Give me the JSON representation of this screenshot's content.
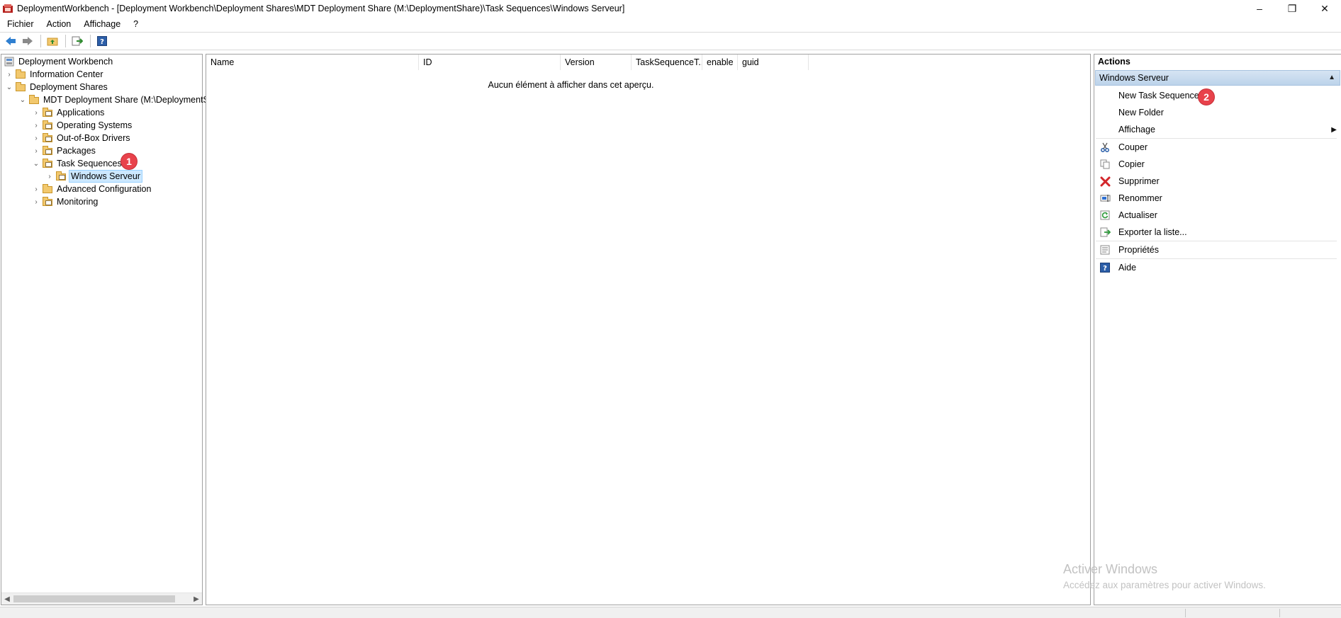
{
  "window": {
    "title": "DeploymentWorkbench - [Deployment Workbench\\Deployment Shares\\MDT Deployment Share (M:\\DeploymentShare)\\Task Sequences\\Windows Serveur]",
    "controls": {
      "minimize": "–",
      "restore": "❐",
      "close": "✕"
    }
  },
  "menu": [
    "Fichier",
    "Action",
    "Affichage",
    "?"
  ],
  "tree": {
    "items": [
      {
        "label": "Deployment Workbench",
        "level": 0,
        "expander": "",
        "icon": "workbench-icon"
      },
      {
        "label": "Information Center",
        "level": 1,
        "expander": "›",
        "icon": "folder-icon"
      },
      {
        "label": "Deployment Shares",
        "level": 1,
        "expander": "⌄",
        "icon": "folder-icon"
      },
      {
        "label": "MDT Deployment Share (M:\\DeploymentShare)",
        "level": 2,
        "expander": "⌄",
        "icon": "folder-icon"
      },
      {
        "label": "Applications",
        "level": 3,
        "expander": "›",
        "icon": "folder-icon"
      },
      {
        "label": "Operating Systems",
        "level": 3,
        "expander": "›",
        "icon": "folder-icon"
      },
      {
        "label": "Out-of-Box Drivers",
        "level": 3,
        "expander": "›",
        "icon": "folder-icon"
      },
      {
        "label": "Packages",
        "level": 3,
        "expander": "›",
        "icon": "folder-icon"
      },
      {
        "label": "Task Sequences",
        "level": 3,
        "expander": "⌄",
        "icon": "folder-icon"
      },
      {
        "label": "Windows Serveur",
        "level": 4,
        "expander": "›",
        "icon": "folder-icon",
        "selected": true
      },
      {
        "label": "Advanced Configuration",
        "level": 3,
        "expander": "›",
        "icon": "folder-icon"
      },
      {
        "label": "Monitoring",
        "level": 3,
        "expander": "›",
        "icon": "folder-icon"
      }
    ]
  },
  "list": {
    "columns": [
      "Name",
      "ID",
      "Version",
      "TaskSequenceT...",
      "enable",
      "guid"
    ],
    "empty_message": "Aucun élément à afficher dans cet aperçu."
  },
  "actions": {
    "header": "Actions",
    "section": "Windows Serveur",
    "items": [
      {
        "label": "New Task Sequence",
        "icon": ""
      },
      {
        "label": "New Folder",
        "icon": ""
      },
      {
        "label": "Affichage",
        "icon": "",
        "submenu": true
      },
      {
        "label": "Couper",
        "icon": "cut-icon"
      },
      {
        "label": "Copier",
        "icon": "copy-icon"
      },
      {
        "label": "Supprimer",
        "icon": "delete-icon"
      },
      {
        "label": "Renommer",
        "icon": "rename-icon"
      },
      {
        "label": "Actualiser",
        "icon": "refresh-icon"
      },
      {
        "label": "Exporter la liste...",
        "icon": "export-icon"
      },
      {
        "label": "Propriétés",
        "icon": "properties-icon"
      },
      {
        "label": "Aide",
        "icon": "help-icon"
      }
    ]
  },
  "badges": {
    "one": "1",
    "two": "2"
  },
  "watermark": {
    "title": "Activer Windows",
    "subtitle": "Accédez aux paramètres pour activer Windows."
  },
  "colors": {
    "selection": "#cce8ff",
    "badge": "#e8424b",
    "folder": "#f2c86d"
  }
}
